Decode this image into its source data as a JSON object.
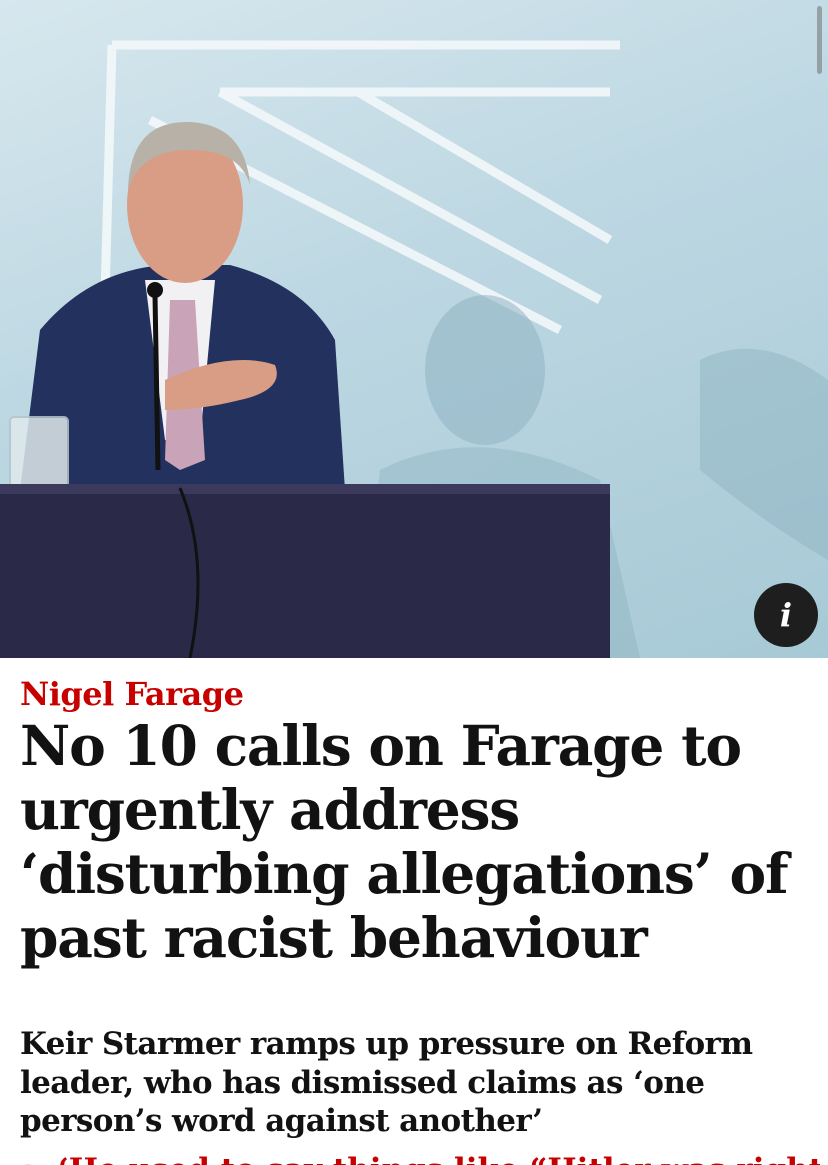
{
  "hero": {
    "info_icon": "info-icon",
    "info_glyph": "i"
  },
  "article": {
    "kicker": "Nigel Farage",
    "headline": "No 10 calls on Farage to urgently address ‘disturbing allegations’ of past racist behaviour",
    "standfirst": "Keir Starmer ramps up pressure on Reform leader, who has dismissed claims as ‘one person’s word against another’",
    "next_item_partial": "‘He used to say things like “Hitler was right”’"
  },
  "colors": {
    "kicker": "#c70000",
    "headline": "#121212",
    "background": "#ffffff",
    "info_button": "#1e1e1e"
  }
}
